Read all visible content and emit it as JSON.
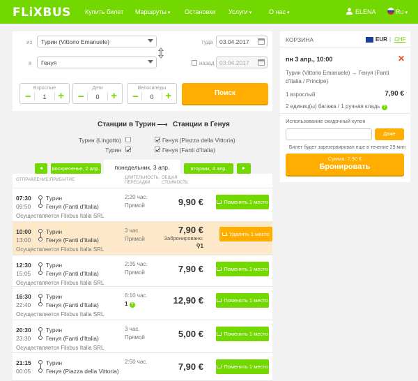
{
  "header": {
    "logo": "FLiXBUS",
    "nav": [
      "Купить билет",
      "Маршруты",
      "Остановки",
      "Услуги",
      "О нас"
    ],
    "user": "ELENA",
    "lang": "Ru"
  },
  "search": {
    "from_label": "из",
    "from_value": "Турин (Vittorio Emanuele)",
    "to_label": "в",
    "to_value": "Генуя",
    "depart_label": "туда",
    "depart_date": "03.04.2017",
    "return_label": "назад",
    "return_date": "03.04.2017",
    "pax": [
      {
        "label": "Взрослые",
        "value": "1"
      },
      {
        "label": "Дети",
        "value": "0"
      },
      {
        "label": "Велосипеды",
        "value": "0"
      }
    ],
    "search_button": "Поиск"
  },
  "stations": {
    "from_title": "Станции в Турин",
    "arrow": "⟶",
    "to_title": "Станции в Генуя",
    "from_items": [
      {
        "name": "Турин (Lingotto)",
        "checked": false
      },
      {
        "name": "Турин",
        "checked": true
      }
    ],
    "to_items": [
      {
        "name": "Генуя (Piazza della Vittoria)",
        "checked": true
      },
      {
        "name": "Генуя (Fanti d'Italia)",
        "checked": true
      }
    ]
  },
  "days": {
    "prev_arrow": "◄",
    "prev_label": "воскресенье, 2 апр.",
    "current_label": "понедельник, 3 апр.",
    "next_label": "вторник, 4 апр.",
    "next_arrow": "►"
  },
  "table_header": {
    "col1": "ОТПРАВЛЕНИЕ/ПРИБЫТИЕ",
    "col2": "ДЛИТЕЛЬНОСТЬ, ПЕРЕСАДКИ",
    "col3": "ОБЩАЯ СТОИМОСТЬ"
  },
  "rides": [
    {
      "dep": "07:30",
      "arr": "09:50",
      "from": "Турин",
      "to": "Генуя (Fanti d'Italia)",
      "operator": "Осуществляется Flixbus Italia SRL",
      "duration": "2:20 час.",
      "transfer": "Прямой",
      "price": "9,90 €",
      "action": "Поменять 1 место",
      "highlight": false
    },
    {
      "dep": "10:00",
      "arr": "13:00",
      "from": "Турин",
      "to": "Генуя (Fanti d'Italia)",
      "operator": "Осуществляется Flixbus Italia SRL",
      "duration": "3 час.",
      "transfer": "Прямой",
      "price": "7,90 €",
      "reserved": "Забронировано:",
      "reserved_count": "1",
      "action": "Удалить 1 место",
      "highlight": true
    },
    {
      "dep": "12:30",
      "arr": "15:05",
      "from": "Турин",
      "to": "Генуя (Fanti d'Italia)",
      "operator": "Осуществляется Flixbus Italia SRL",
      "duration": "2:35 час.",
      "transfer": "Прямой",
      "price": "7,90 €",
      "action": "Поменять 1 место",
      "highlight": false
    },
    {
      "dep": "16:30",
      "arr": "22:40",
      "from": "Турин",
      "to": "Генуя (Fanti d'Italia)",
      "operator": "Осуществляется Flixbus Italia SRL",
      "duration": "6:10 час.",
      "transfer": "1",
      "price": "12,90 €",
      "action": "Поменять 1 место",
      "highlight": false
    },
    {
      "dep": "20:30",
      "arr": "23:30",
      "from": "Турин",
      "to": "Генуя (Fanti d'Italia)",
      "operator": "Осуществляется Flixbus Italia SRL",
      "duration": "3 час.",
      "transfer": "Прямой",
      "price": "5,00 €",
      "action": "Поменять 1 место",
      "highlight": false
    },
    {
      "dep": "21:15",
      "arr": "00:05",
      "from": "Турин",
      "to": "Генуя (Piazza della Vittoria)",
      "operator": "",
      "duration": "2:50 час.",
      "transfer": "",
      "price": "7,90 €",
      "action": "Поменять 1 место",
      "highlight": false
    }
  ],
  "cart": {
    "title": "КОРЗИНА",
    "cur_eur": "EUR",
    "cur_sep": "|",
    "cur_chf": "CHF",
    "date_line": "пн 3 апр., 10:00",
    "route": "Турин (Vittorio Emanuele) → Генуя (Fanti d'Italia / Principe)",
    "pax_line": "1 взрослый",
    "price": "7,90 €",
    "luggage": "2 единиц(ы) багажа / 1 ручная кладь",
    "coupon_label": "Использование скидочный купон",
    "coupon_placeholder": "",
    "coupon_button": "Даже",
    "reserved_note": "Билет будет зарезервирован еще в течение 29 мин",
    "total_line": "Сумма: 7,90 €",
    "book_button": "Бронировать"
  },
  "colors": {
    "green": "#73d700",
    "orange": "#ffad00",
    "red": "#e84c1e"
  }
}
